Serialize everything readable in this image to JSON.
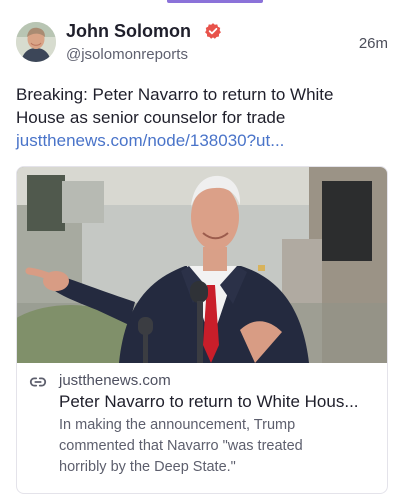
{
  "post": {
    "author_name": "John Solomon",
    "handle": "@jsolomonreports",
    "timestamp": "26m",
    "text_lines": [
      "Breaking: Peter Navarro to return to White",
      "House as senior counselor for trade"
    ],
    "link_text": "justthenews.com/node/138030?ut...",
    "avatar_icon": "person-photo",
    "verified_icon": "verified-badge",
    "verified_color": "#e8534b",
    "link_color": "#4a74c9"
  },
  "card": {
    "image_icon": "news-photo",
    "link_icon": "link-icon",
    "domain": "justthenews.com",
    "title": "Peter Navarro to return to White Hous...",
    "description_lines": [
      "In making the announcement, Trump",
      "commented that Navarro \"was treated",
      "horribly by the Deep State.\""
    ]
  },
  "tab_indicator_color": "#8b72d9"
}
